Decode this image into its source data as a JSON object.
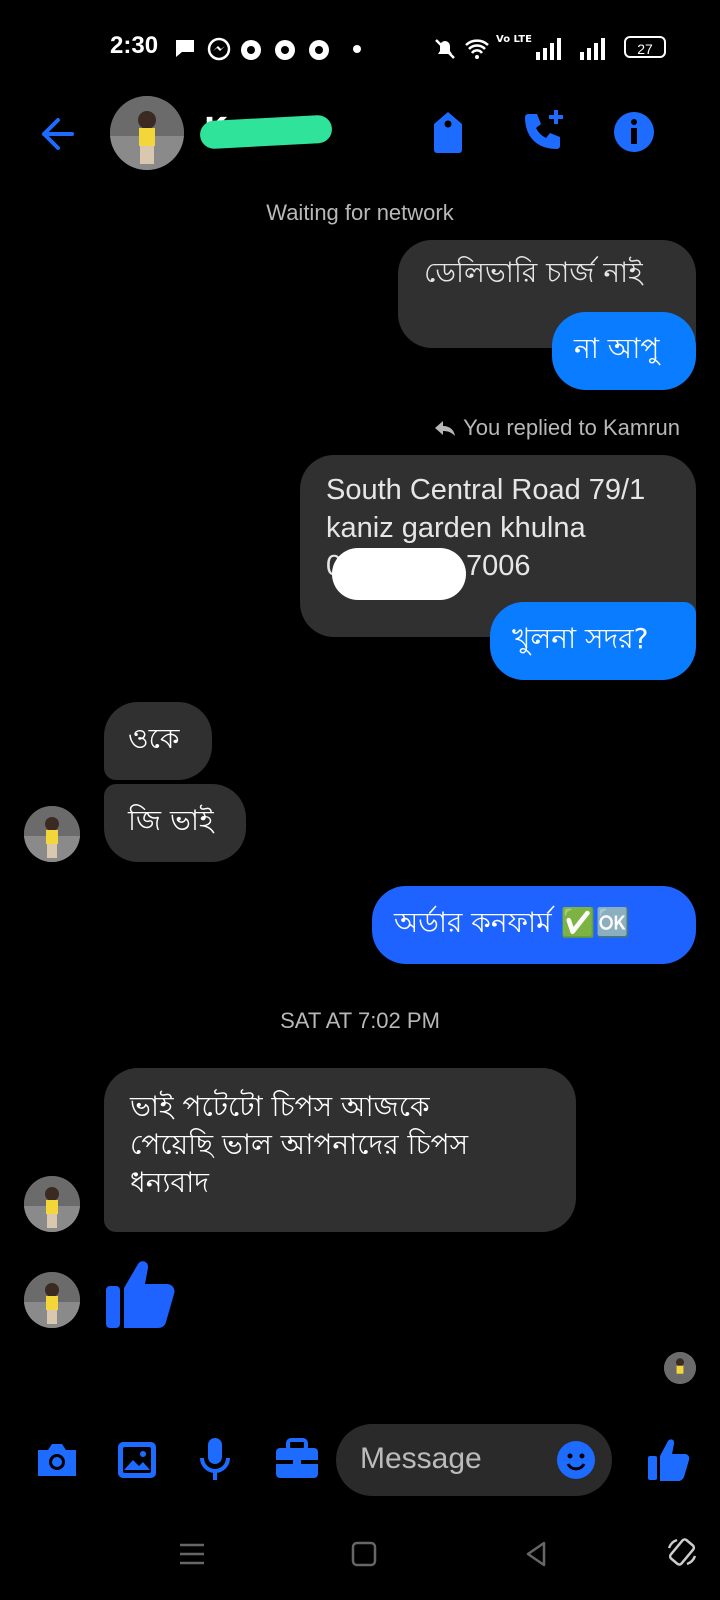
{
  "status_bar": {
    "time": "2:30",
    "battery": "27",
    "network_label": "Vo LTE"
  },
  "header": {
    "contact_name": "K",
    "icons": [
      "back-arrow-icon",
      "avatar",
      "tag-icon",
      "phone-plus-icon",
      "info-icon"
    ]
  },
  "conversation": {
    "network_status": "Waiting for network",
    "messages": [
      {
        "id": "m1",
        "direction": "out",
        "style": "grey",
        "text": "ডেলিভারি চার্জ  নাই"
      },
      {
        "id": "m2",
        "direction": "out",
        "style": "blue",
        "text": "না আপু"
      },
      {
        "id": "m3",
        "direction": "out",
        "style": "grey",
        "text": "South Central Road 79/1\nkaniz garden khulna\n01         7006",
        "reply_context": "You replied to Kamrun"
      },
      {
        "id": "m4",
        "direction": "out",
        "style": "blue",
        "text": "খুলনা সদর?"
      },
      {
        "id": "m5",
        "direction": "in",
        "text": "ওকে"
      },
      {
        "id": "m6",
        "direction": "in",
        "text": "জি ভাই"
      },
      {
        "id": "m7",
        "direction": "out",
        "style": "blue",
        "text": "অর্ডার কনফার্ম ✅🆗"
      },
      {
        "id": "m8",
        "direction": "in",
        "text": "ভাই  পটেটো চিপস আজকে\nপেয়েছি ভাল আপনাদের চিপস\nধন্যবাদ"
      },
      {
        "id": "m9",
        "direction": "in",
        "type": "thumbs-up"
      }
    ],
    "timestamp": "SAT AT 7:02 PM",
    "address_lines": [
      "South Central Road 79/1",
      "kaniz garden khulna",
      "01",
      "7006"
    ]
  },
  "composer": {
    "placeholder": "Message",
    "icons": [
      "camera-icon",
      "image-icon",
      "mic-icon",
      "briefcase-icon",
      "emoji-icon",
      "like-icon"
    ]
  },
  "colors": {
    "accent": "#0a7cff",
    "background": "#000000",
    "bubble_grey": "#303030",
    "icon_blue": "#1e6bff"
  }
}
